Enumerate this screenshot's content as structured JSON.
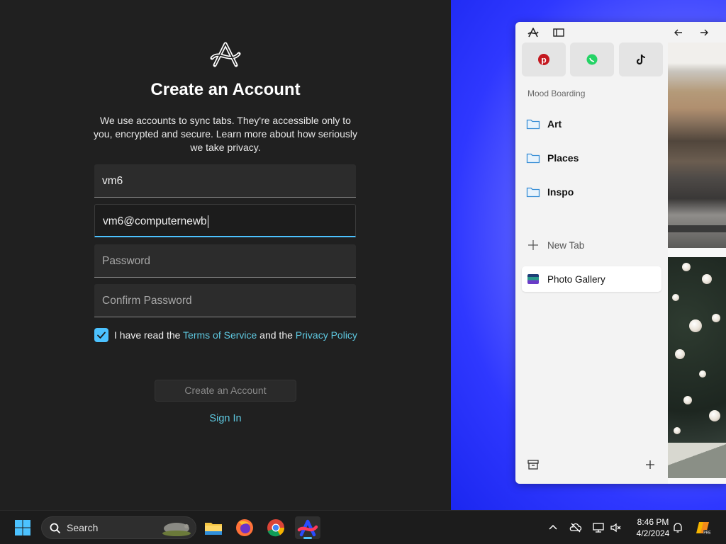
{
  "signup": {
    "title": "Create an Account",
    "description": "We use accounts to sync tabs. They're accessible only to you, encrypted and secure. Learn more about how seriously we take privacy.",
    "fields": {
      "name_value": "vm6",
      "email_value": "vm6@computernewb",
      "password_placeholder": "Password",
      "confirm_placeholder": "Confirm Password"
    },
    "terms_checked": true,
    "agree_prefix": "I have read the ",
    "terms_link": "Terms of Service",
    "agree_mid": " and the ",
    "privacy_link": "Privacy Policy",
    "create_button": "Create an Account",
    "signin_link": "Sign In",
    "accent_color": "#4cc2ff",
    "link_color": "#5ec8e0"
  },
  "browser": {
    "favorites": [
      {
        "icon": "pinterest-icon",
        "color": "#c4181f"
      },
      {
        "icon": "whatsapp-icon",
        "color": "#25d366"
      },
      {
        "icon": "tiktok-icon",
        "color": "#111111"
      }
    ],
    "section_label": "Mood Boarding",
    "folders": [
      "Art",
      "Places",
      "Inspo"
    ],
    "new_tab": "New Tab",
    "active_tab": "Photo Gallery"
  },
  "taskbar": {
    "search_label": "Search",
    "apps": [
      "start-icon",
      "file-explorer-icon",
      "firefox-icon",
      "chrome-icon",
      "arc-icon"
    ],
    "time": "8:46 PM",
    "date": "4/2/2024"
  }
}
